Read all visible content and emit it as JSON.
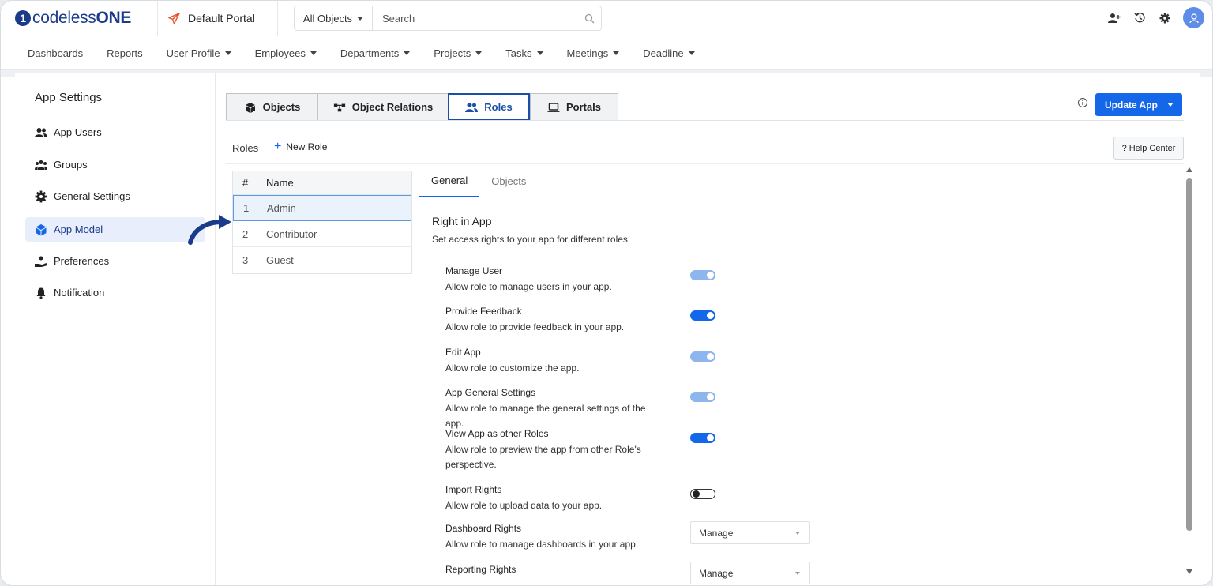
{
  "brand": {
    "logo_mark": "1",
    "logo_prefix": "codeless",
    "logo_suffix": "ONE"
  },
  "portal": {
    "name": "Default Portal",
    "icon": "paper-plane-icon",
    "accent": "#e8552b"
  },
  "search": {
    "scope": "All Objects",
    "placeholder": "Search"
  },
  "top_icons": [
    "add-user-icon",
    "history-icon",
    "gear-icon",
    "user-avatar-icon"
  ],
  "nav": [
    {
      "label": "Dashboards",
      "dropdown": false
    },
    {
      "label": "Reports",
      "dropdown": false
    },
    {
      "label": "User Profile",
      "dropdown": true
    },
    {
      "label": "Employees",
      "dropdown": true
    },
    {
      "label": "Departments",
      "dropdown": true
    },
    {
      "label": "Projects",
      "dropdown": true
    },
    {
      "label": "Tasks",
      "dropdown": true
    },
    {
      "label": "Meetings",
      "dropdown": true
    },
    {
      "label": "Deadline",
      "dropdown": true
    }
  ],
  "sidebar": {
    "title": "App Settings",
    "items": [
      {
        "label": "App Users",
        "icon": "users-icon"
      },
      {
        "label": "Groups",
        "icon": "group-icon"
      },
      {
        "label": "General Settings",
        "icon": "gear-icon"
      },
      {
        "label": "App Model",
        "icon": "cube-icon",
        "active": true
      },
      {
        "label": "Preferences",
        "icon": "hand-icon"
      },
      {
        "label": "Notification",
        "icon": "bell-icon"
      }
    ]
  },
  "tabs": [
    {
      "label": "Objects",
      "icon": "cube-icon"
    },
    {
      "label": "Object Relations",
      "icon": "relations-icon"
    },
    {
      "label": "Roles",
      "icon": "users-icon",
      "active": true
    },
    {
      "label": "Portals",
      "icon": "laptop-icon"
    }
  ],
  "actions": {
    "update_app": "Update App",
    "help_center": "? Help Center",
    "new_role": "New Role"
  },
  "roles": {
    "label": "Roles",
    "columns": [
      "#",
      "Name"
    ],
    "rows": [
      {
        "num": "1",
        "name": "Admin",
        "selected": true
      },
      {
        "num": "2",
        "name": "Contributor"
      },
      {
        "num": "3",
        "name": "Guest"
      }
    ]
  },
  "detail": {
    "tabs": [
      "General",
      "Objects"
    ],
    "section_title": "Right in App",
    "section_sub": "Set access rights to your app for different roles",
    "permissions": [
      {
        "title": "Manage User",
        "desc": "Allow role to manage users in your app.",
        "state": "on-disabled"
      },
      {
        "title": "Provide Feedback",
        "desc": "Allow role to provide feedback in your app.",
        "state": "on"
      },
      {
        "title": "Edit App",
        "desc": "Allow role to customize the app.",
        "state": "on-disabled"
      },
      {
        "title": "App General Settings",
        "desc": "Allow role to manage the general settings of the app.",
        "state": "on-disabled"
      },
      {
        "title": "View App as other Roles",
        "desc": "Allow role to preview the app from other Role's perspective.",
        "state": "on"
      },
      {
        "title": "Import Rights",
        "desc": "Allow role to upload data to your app.",
        "state": "off"
      },
      {
        "title": "Dashboard Rights",
        "desc": "Allow role to manage dashboards in your app.",
        "select": "Manage"
      },
      {
        "title": "Reporting Rights",
        "desc": "",
        "select": "Manage"
      }
    ]
  },
  "colors": {
    "primary": "#1467e8",
    "brand": "#1a3a8a",
    "toggle_disabled": "#8db5ee"
  }
}
